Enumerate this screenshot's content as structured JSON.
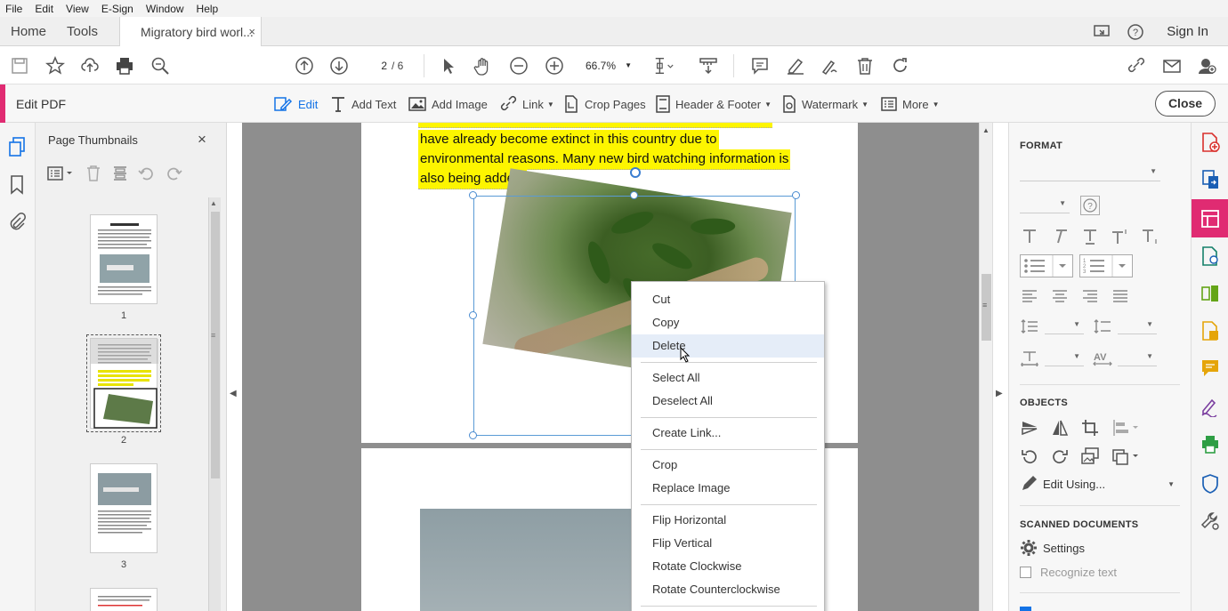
{
  "menu": [
    "File",
    "Edit",
    "View",
    "E-Sign",
    "Window",
    "Help"
  ],
  "tabs": {
    "home": "Home",
    "tools": "Tools",
    "document": "Migratory bird worl...",
    "close": "×",
    "sign_in": "Sign In"
  },
  "toolbar": {
    "current_page": "2",
    "total_pages": "/ 6",
    "zoom": "66.7%"
  },
  "editbar": {
    "title": "Edit PDF",
    "edit": "Edit",
    "add_text": "Add Text",
    "add_image": "Add Image",
    "link": "Link",
    "crop_pages": "Crop Pages",
    "header_footer": "Header & Footer",
    "watermark": "Watermark",
    "more": "More",
    "close": "Close"
  },
  "thumbnails": {
    "title": "Page Thumbnails",
    "close": "×",
    "pages": [
      "1",
      "2",
      "3"
    ]
  },
  "document": {
    "text_lines": [
      "have already become extinct in this country due to",
      "environmental reasons. Many new bird watching information is",
      "also being added."
    ]
  },
  "context_menu": {
    "items": [
      "Cut",
      "Copy",
      "Delete",
      "Select All",
      "Deselect All",
      "Create Link...",
      "Crop",
      "Replace Image",
      "Flip Horizontal",
      "Flip Vertical",
      "Rotate Clockwise",
      "Rotate Counterclockwise"
    ],
    "hovered": "Delete"
  },
  "format_panel": {
    "format_title": "FORMAT",
    "objects_title": "OBJECTS",
    "edit_using": "Edit Using...",
    "scanned_title": "SCANNED DOCUMENTS",
    "settings": "Settings",
    "recognize_text": "Recognize text"
  },
  "colors": {
    "accent": "#e02b72",
    "highlight": "#fdf500",
    "selection": "#5a9bd5",
    "link_blue": "#1473e6"
  }
}
